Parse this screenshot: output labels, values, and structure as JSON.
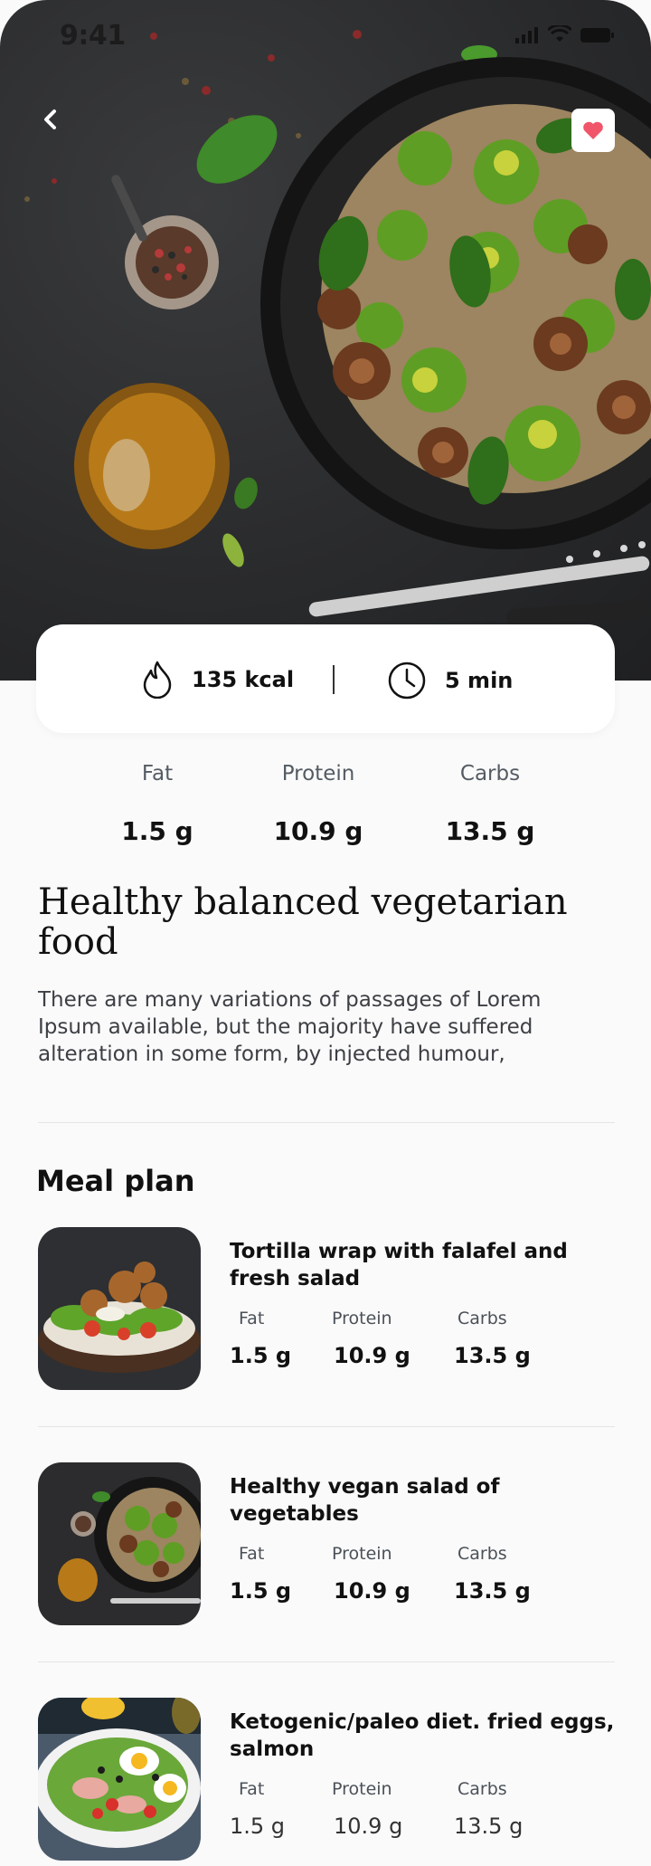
{
  "status": {
    "time": "9:41"
  },
  "hero": {
    "favorite_color": "#f0556a"
  },
  "info": {
    "calories": "135 kcal",
    "time": "5 min"
  },
  "nutrients": {
    "fat_label": "Fat",
    "protein_label": "Protein",
    "carbs_label": "Carbs",
    "fat": "1.5 g",
    "protein": "10.9 g",
    "carbs": "13.5 g"
  },
  "recipe": {
    "title": "Healthy balanced vegetarian food",
    "description": "There are many variations of passages of Lorem Ipsum available, but the majority have suffered alteration in some form, by injected humour,"
  },
  "meal_plan": {
    "heading": "Meal plan",
    "items": [
      {
        "name": "Tortilla wrap with falafel and fresh salad",
        "fat_label": "Fat",
        "protein_label": "Protein",
        "carbs_label": "Carbs",
        "fat": "1.5 g",
        "protein": "10.9 g",
        "carbs": "13.5 g"
      },
      {
        "name": "Healthy vegan salad of vegetables",
        "fat_label": "Fat",
        "protein_label": "Protein",
        "carbs_label": "Carbs",
        "fat": "1.5 g",
        "protein": "10.9 g",
        "carbs": "13.5 g"
      },
      {
        "name": "Ketogenic/paleo diet. fried eggs, salmon",
        "fat_label": "Fat",
        "protein_label": "Protein",
        "carbs_label": "Carbs",
        "fat": "1.5 g",
        "protein": "10.9 g",
        "carbs": "13.5 g"
      }
    ]
  }
}
